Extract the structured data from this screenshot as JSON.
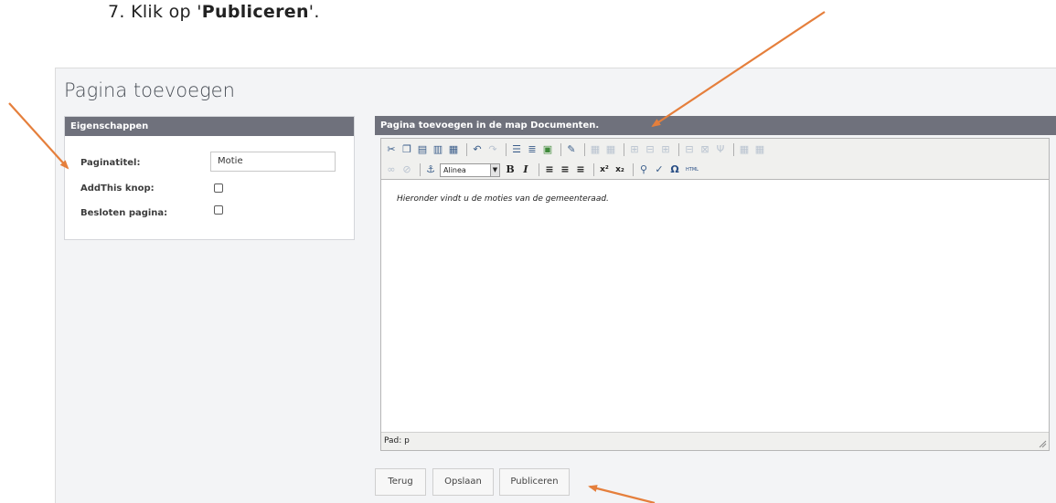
{
  "instruction": {
    "prefix": "7. Klik op '",
    "bold": "Publiceren",
    "suffix": "'."
  },
  "page": {
    "title": "Pagina toevoegen"
  },
  "properties": {
    "header": "Eigenschappen",
    "title_label": "Paginatitel:",
    "title_value": "Motie",
    "addthis_label": "AddThis knop:",
    "addthis_checked": false,
    "closed_label": "Besloten pagina:",
    "closed_checked": false
  },
  "editor": {
    "header": "Pagina toevoegen in de map Documenten.",
    "format_select": "Alinea",
    "content": "Hieronder vindt u de moties van de gemeenteraad.",
    "path": "Pad: p",
    "toolbar_row1": [
      "cut-icon",
      "copy-icon",
      "paste-icon",
      "paste-text-icon",
      "paste-word-icon",
      "undo-icon",
      "redo-icon",
      "bullet-list-icon",
      "numbered-list-icon",
      "image-icon",
      "edit-icon",
      "table-icon",
      "table-props-icon",
      "row-insert-icon",
      "row-delete-icon",
      "col-insert-icon",
      "col-delete-icon",
      "split-cell-icon",
      "merge-cell-icon",
      "cell-props-icon",
      "table-delete-icon"
    ],
    "toolbar_row2": [
      "link-icon",
      "unlink-icon",
      "anchor-icon",
      "bold-icon",
      "italic-icon",
      "align-left-icon",
      "align-center-icon",
      "align-right-icon",
      "superscript-icon",
      "subscript-icon",
      "find-icon",
      "spellcheck-icon",
      "special-char-icon",
      "html-icon"
    ]
  },
  "buttons": {
    "back": "Terug",
    "save": "Opslaan",
    "publish": "Publiceren"
  },
  "colors": {
    "panel_header": "#6f717c",
    "arrow": "#e57f3c",
    "background": "#f3f4f6"
  }
}
